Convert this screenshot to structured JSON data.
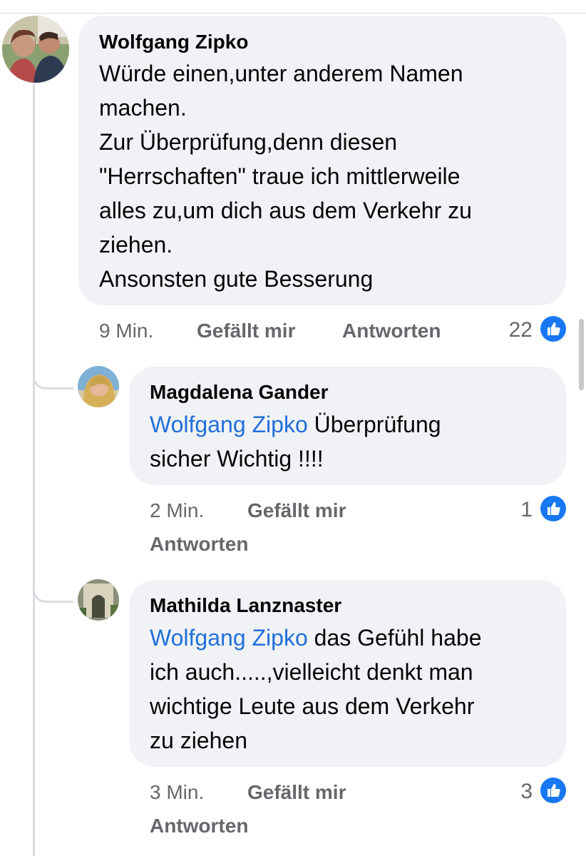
{
  "comments": [
    {
      "author": "Wolfgang Zipko",
      "text_lines": [
        "Würde einen,unter anderem Namen",
        "machen.",
        "Zur Überprüfung,denn diesen",
        "\"Herrschaften\" traue ich mittlerweile",
        "alles zu,um dich aus dem  Verkehr zu",
        "ziehen.",
        "Ansonsten gute Besserung"
      ],
      "time": "9 Min.",
      "like_label": "Gefällt mir",
      "reply_label": "Antworten",
      "reactions": "22",
      "reaction_icon": "thumbs-up-icon"
    },
    {
      "author": "Magdalena Gander",
      "mention": "Wolfgang Zipko",
      "line1_rest": " Überprüfung",
      "text_lines": [
        "sicher Wichtig !!!!"
      ],
      "time": "2 Min.",
      "like_label": "Gefällt mir",
      "reply_label": "Antworten",
      "reactions": "1",
      "reaction_icon": "thumbs-up-icon"
    },
    {
      "author": "Mathilda Lanznaster",
      "mention": "Wolfgang Zipko",
      "line1_rest": " das Gefühl habe",
      "text_lines": [
        "ich auch.....,vielleicht   denkt man",
        "wichtige Leute  aus dem  Verkehr",
        "zu ziehen"
      ],
      "time": "3 Min.",
      "like_label": "Gefällt mir",
      "reply_label": "Antworten",
      "reactions": "3",
      "reaction_icon": "thumbs-up-icon"
    }
  ],
  "colors": {
    "bubble": "#f0f2f5",
    "mention": "#216fdb",
    "meta": "#65676b",
    "like": "#1877f2"
  }
}
